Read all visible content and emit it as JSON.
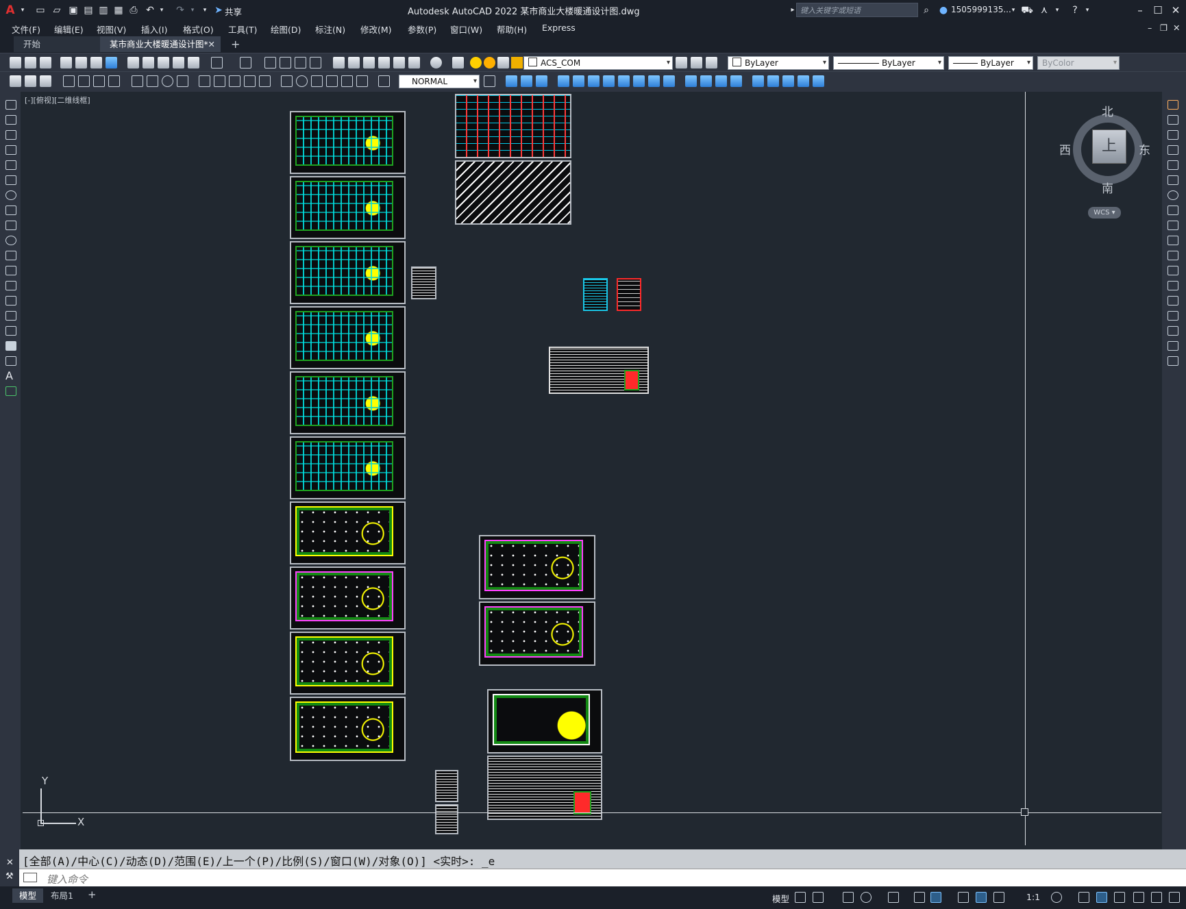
{
  "titlebar": {
    "app_logo": "A",
    "share_label": "共享",
    "title": "Autodesk AutoCAD 2022    某市商业大楼暖通设计图.dwg",
    "search_placeholder": "键入关键字或短语",
    "user": "1505999135...",
    "icons": [
      "new-icon",
      "open-icon",
      "save-icon",
      "saveas-icon",
      "open-web-icon",
      "save-web-icon",
      "plot-icon",
      "undo-icon",
      "redo-icon",
      "share-icon",
      "search-icon",
      "user-icon",
      "cart-icon",
      "autodesk-app-icon",
      "help-icon"
    ]
  },
  "menubar": {
    "items": [
      "文件(F)",
      "编辑(E)",
      "视图(V)",
      "插入(I)",
      "格式(O)",
      "工具(T)",
      "绘图(D)",
      "标注(N)",
      "修改(M)",
      "参数(P)",
      "窗口(W)",
      "帮助(H)",
      "Express"
    ]
  },
  "tabs": {
    "items": [
      "开始",
      "某市商业大楼暖通设计图*"
    ],
    "active_index": 1,
    "add_label": "+"
  },
  "toolbar1": {
    "layer_combo": "ACS_COM",
    "color_combo": "ByLayer",
    "linetype_combo": "ByLayer",
    "lineweight_combo": "ByLayer",
    "plotstyle_combo": "ByColor"
  },
  "toolbar2": {
    "dimstyle_combo": "NORMAL"
  },
  "viewport": {
    "label": "[-][俯视][二维线框]"
  },
  "viewcube": {
    "north": "北",
    "south": "南",
    "east": "东",
    "west": "西",
    "face": "上",
    "wcs": "WCS"
  },
  "ucs": {
    "x_label": "X",
    "y_label": "Y"
  },
  "command": {
    "history": "[全部(A)/中心(C)/动态(D)/范围(E)/上一个(P)/比例(S)/窗口(W)/对象(O)] <实时>: _e",
    "placeholder": "键入命令"
  },
  "statusbar": {
    "model_tab": "模型",
    "layout_tab": "布局1",
    "add_label": "+",
    "model_button": "模型",
    "scale": "1:1"
  },
  "colors": {
    "background": "#212830",
    "chrome": "#1b2029",
    "toolbar": "#2e3440",
    "accent": "#7ec3ff"
  }
}
